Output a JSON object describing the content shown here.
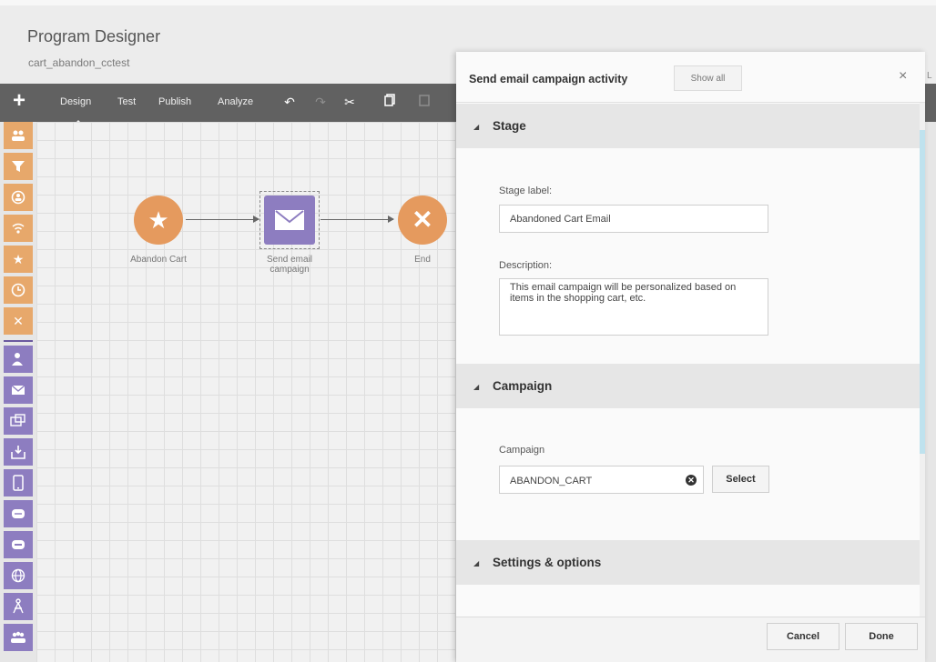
{
  "header": {
    "title": "Program Designer",
    "subtitle": "cart_abandon_cctest",
    "cutoff_text": "L"
  },
  "toolbar": {
    "add_icon": "plus-icon",
    "tabs": [
      {
        "label": "Design",
        "active": true
      },
      {
        "label": "Test"
      },
      {
        "label": "Publish"
      },
      {
        "label": "Analyze"
      }
    ],
    "tools": [
      "undo-icon",
      "redo-icon",
      "cut-icon",
      "copy-icon",
      "paste-icon"
    ]
  },
  "palette": {
    "orange_items": [
      "segment-icon",
      "filter-icon",
      "event-icon",
      "wifi-icon",
      "star-icon",
      "clock-icon",
      "close-icon"
    ],
    "purple_items": [
      "person-icon",
      "email-icon",
      "sms-icon",
      "inbox-icon",
      "mobile-icon",
      "message-icon",
      "data-icon",
      "web-icon",
      "compass-icon",
      "group-icon"
    ]
  },
  "canvas": {
    "nodes": [
      {
        "label": "Abandon Cart",
        "icon": "star-icon"
      },
      {
        "label": "Send email campaign",
        "icon": "email-icon"
      },
      {
        "label": "End",
        "icon": "x-icon"
      }
    ]
  },
  "panel": {
    "title": "Send email campaign activity",
    "show_all": "Show all",
    "close": "×",
    "sections": {
      "stage": {
        "header": "Stage",
        "stage_label_caption": "Stage label:",
        "stage_label_value": "Abandoned Cart Email",
        "description_caption": "Description:",
        "description_value": "This email campaign will be personalized based on items in the shopping cart, etc."
      },
      "campaign": {
        "header": "Campaign",
        "campaign_caption": "Campaign",
        "campaign_value": "ABANDON_CART",
        "select_label": "Select"
      },
      "settings": {
        "header": "Settings & options"
      }
    },
    "footer": {
      "cancel": "Cancel",
      "done": "Done"
    }
  },
  "colors": {
    "orange": "#e59a5e",
    "purple": "#8d7dc0",
    "toolbar": "#616161",
    "scroll_accent": "#bfe2ee"
  }
}
